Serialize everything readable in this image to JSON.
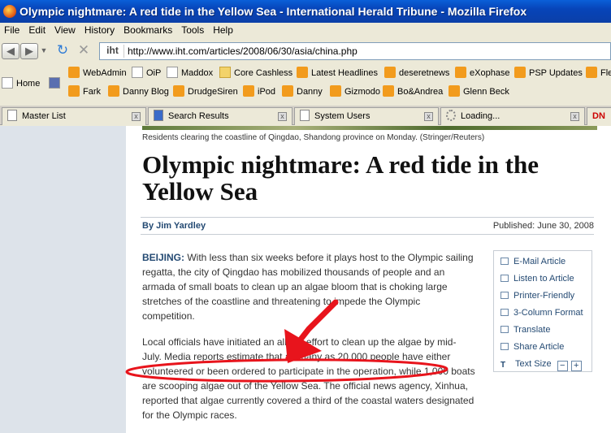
{
  "window": {
    "title": "Olympic nightmare: A red tide in the Yellow Sea - International Herald Tribune - Mozilla Firefox"
  },
  "menu": [
    "File",
    "Edit",
    "View",
    "History",
    "Bookmarks",
    "Tools",
    "Help"
  ],
  "address": {
    "site_label": "iht",
    "url": "http://www.iht.com/articles/2008/06/30/asia/china.php"
  },
  "bookmarks_row1": [
    "WebAdmin",
    "OiP",
    "Maddox",
    "Core Cashless",
    "Latest Headlines",
    "deseretnews",
    "eXophase",
    "PSP Updates",
    "Fle"
  ],
  "bookmarks_row2": [
    "Home",
    "Fark",
    "Danny Blog",
    "DrudgeSiren",
    "iPod",
    "Danny",
    "Gizmodo",
    "Bo&Andrea",
    "Glenn Beck"
  ],
  "tabs": [
    "Master List",
    "Search Results",
    "System Users",
    "Loading...",
    "DN"
  ],
  "article": {
    "caption": "Residents clearing the coastline of Qingdao, Shandong province on Monday. (Stringer/Reuters)",
    "headline": "Olympic nightmare: A red tide in the Yellow Sea",
    "byline": "By Jim Yardley",
    "published": "Published: June 30, 2008",
    "dateline": "BEIJING:",
    "para1": " With less than six weeks before it plays host to the Olympic sailing regatta, the city of Qingdao has mobilized thousands of people and an armada of small boats to clean up an algae bloom that is choking large stretches of the coastline and threatening to impede the Olympic competition.",
    "para2": "Local officials have initiated an all-out effort to clean up the algae by mid-July. Media reports estimate that as many as 20,000 people have either volunteered or been ordered to participate in the operation, while 1,000 boats are scooping algae out of the Yellow Sea. The official news agency, Xinhua, reported that algae currently covered a third of the coastal waters designated for the Olympic races."
  },
  "tools": [
    "E-Mail Article",
    "Listen to Article",
    "Printer-Friendly",
    "3-Column Format",
    "Translate",
    "Share Article",
    "Text Size"
  ],
  "tool_size": {
    "minus": "−",
    "plus": "+"
  },
  "colors": {
    "annotation": "#e8141c",
    "link": "#244a73"
  }
}
